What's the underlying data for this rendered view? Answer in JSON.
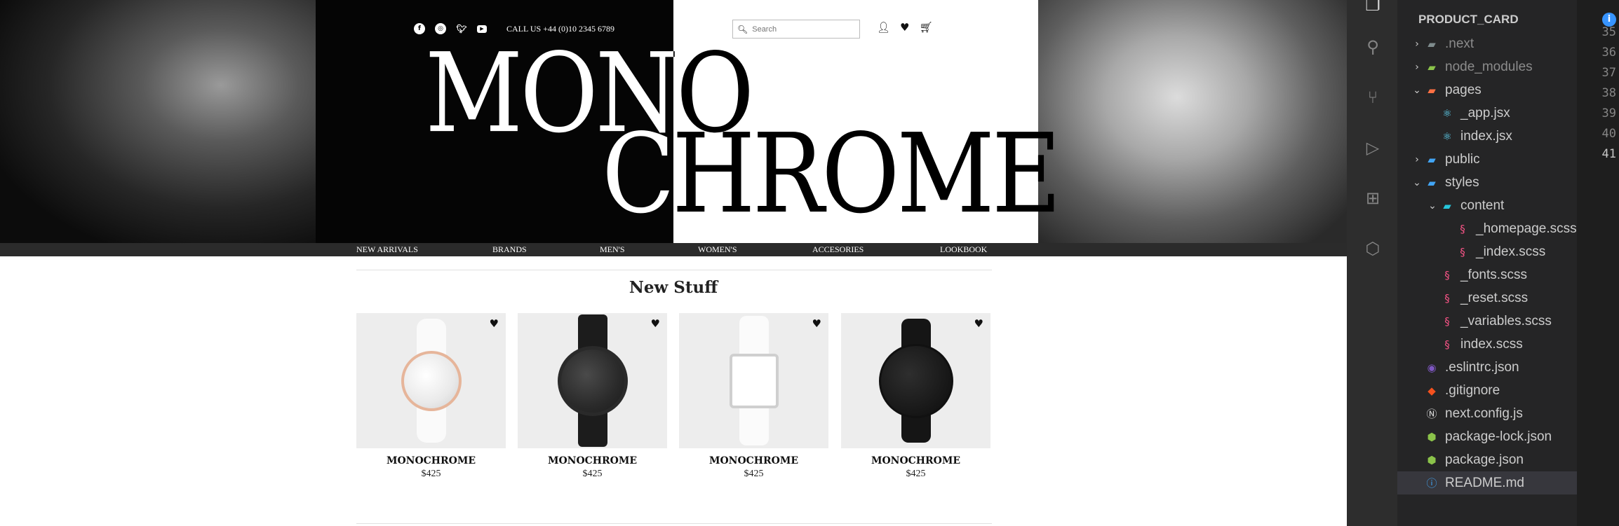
{
  "site": {
    "brand_line1": "MONO",
    "brand_line2": "CHROME",
    "phone": "CALL US +44 (0)10 2345 6789",
    "search_placeholder": "Search",
    "social_icons": [
      "facebook-icon",
      "instagram-icon",
      "twitter-icon",
      "youtube-icon"
    ],
    "nav": [
      "NEW ARRIVALS",
      "BRANDS",
      "MEN'S",
      "WOMEN'S",
      "ACCESORIES",
      "LOOKBOOK"
    ],
    "section_title": "New Stuff",
    "products": [
      {
        "name": "MONOCHROME",
        "price": "$425"
      },
      {
        "name": "MONOCHROME",
        "price": "$425"
      },
      {
        "name": "MONOCHROME",
        "price": "$425"
      },
      {
        "name": "MONOCHROME",
        "price": "$425"
      }
    ]
  },
  "vscode": {
    "explorer_title": "PRODUCT_CARD",
    "tree": [
      {
        "label": ".next"
      },
      {
        "label": "node_modules"
      },
      {
        "label": "pages"
      },
      {
        "label": "_app.jsx"
      },
      {
        "label": "index.jsx"
      },
      {
        "label": "public"
      },
      {
        "label": "styles"
      },
      {
        "label": "content"
      },
      {
        "label": "_homepage.scss"
      },
      {
        "label": "_index.scss"
      },
      {
        "label": "_fonts.scss"
      },
      {
        "label": "_reset.scss"
      },
      {
        "label": "_variables.scss"
      },
      {
        "label": "index.scss"
      },
      {
        "label": ".eslintrc.json"
      },
      {
        "label": ".gitignore"
      },
      {
        "label": "next.config.js"
      },
      {
        "label": "package-lock.json"
      },
      {
        "label": "package.json"
      },
      {
        "label": "README.md"
      }
    ],
    "line_numbers": [
      "35",
      "36",
      "37",
      "38",
      "39",
      "40",
      "41"
    ],
    "colors": {
      "activity_bar": "#2d2d2d",
      "sidebar": "#252526",
      "selection": "#37373d",
      "folder": "#dcb67a",
      "scss": "#f55385",
      "react": "#61dafb",
      "json": "#8bc34a",
      "git": "#f4511e"
    }
  }
}
